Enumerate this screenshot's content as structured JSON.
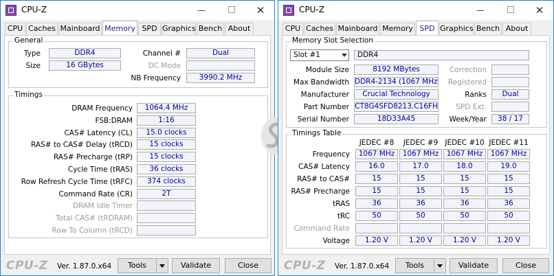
{
  "left": {
    "title": "CPU-Z",
    "tabs": [
      "CPU",
      "Caches",
      "Mainboard",
      "Memory",
      "SPD",
      "Graphics",
      "Bench",
      "About"
    ],
    "active_tab": "Memory",
    "general": {
      "title": "General",
      "type_label": "Type",
      "type": "DDR4",
      "size_label": "Size",
      "size": "16 GBytes",
      "channel_label": "Channel #",
      "channel": "Dual",
      "dcmode_label": "DC Mode",
      "dcmode": "",
      "nbfreq_label": "NB Frequency",
      "nbfreq": "3990.2 MHz"
    },
    "timings": {
      "title": "Timings",
      "rows": [
        {
          "label": "DRAM Frequency",
          "value": "1064.4 MHz",
          "disabled": false
        },
        {
          "label": "FSB:DRAM",
          "value": "1:16",
          "disabled": false
        },
        {
          "label": "CAS# Latency (CL)",
          "value": "15.0 clocks",
          "disabled": false
        },
        {
          "label": "RAS# to CAS# Delay (tRCD)",
          "value": "15 clocks",
          "disabled": false
        },
        {
          "label": "RAS# Precharge (tRP)",
          "value": "15 clocks",
          "disabled": false
        },
        {
          "label": "Cycle Time (tRAS)",
          "value": "36 clocks",
          "disabled": false
        },
        {
          "label": "Row Refresh Cycle Time (tRFC)",
          "value": "374 clocks",
          "disabled": false
        },
        {
          "label": "Command Rate (CR)",
          "value": "2T",
          "disabled": false
        },
        {
          "label": "DRAM Idle Timer",
          "value": "",
          "disabled": true
        },
        {
          "label": "Total CAS# (tRDRAM)",
          "value": "",
          "disabled": true
        },
        {
          "label": "Row To Column (tRCD)",
          "value": "",
          "disabled": true
        }
      ]
    },
    "footer": {
      "brand": "CPU-Z",
      "version": "Ver. 1.87.0.x64",
      "tools": "Tools",
      "validate": "Validate",
      "close": "Close"
    }
  },
  "right": {
    "title": "CPU-Z",
    "tabs": [
      "CPU",
      "Caches",
      "Mainboard",
      "Memory",
      "SPD",
      "Graphics",
      "Bench",
      "About"
    ],
    "active_tab": "SPD",
    "slot": {
      "title": "Memory Slot Selection",
      "selected": "Slot #1",
      "type": "DDR4",
      "module_size_label": "Module Size",
      "module_size": "8192 MBytes",
      "max_bw_label": "Max Bandwidth",
      "max_bw": "DDR4-2134 (1067 MHz)",
      "manufacturer_label": "Manufacturer",
      "manufacturer": "Crucial Technology",
      "part_label": "Part Number",
      "part": "CT8G4SFD8213.C16FH",
      "serial_label": "Serial Number",
      "serial": "18D33A45",
      "correction_label": "Correction",
      "correction": "",
      "registered_label": "Registered",
      "registered": "",
      "ranks_label": "Ranks",
      "ranks": "Dual",
      "spdext_label": "SPD Ext.",
      "spdext": "",
      "weekyear_label": "Week/Year",
      "weekyear": "38 / 17"
    },
    "timings_table": {
      "title": "Timings Table",
      "columns": [
        "JEDEC #8",
        "JEDEC #9",
        "JEDEC #10",
        "JEDEC #11"
      ],
      "rows": [
        {
          "label": "Frequency",
          "values": [
            "1067 MHz",
            "1067 MHz",
            "1067 MHz",
            "1067 MHz"
          ],
          "disabled": false
        },
        {
          "label": "CAS# Latency",
          "values": [
            "16.0",
            "17.0",
            "18.0",
            "19.0"
          ],
          "disabled": false
        },
        {
          "label": "RAS# to CAS#",
          "values": [
            "15",
            "15",
            "15",
            "15"
          ],
          "disabled": false
        },
        {
          "label": "RAS# Precharge",
          "values": [
            "15",
            "15",
            "15",
            "15"
          ],
          "disabled": false
        },
        {
          "label": "tRAS",
          "values": [
            "36",
            "36",
            "36",
            "36"
          ],
          "disabled": false
        },
        {
          "label": "tRC",
          "values": [
            "50",
            "50",
            "50",
            "50"
          ],
          "disabled": false
        },
        {
          "label": "Command Rate",
          "values": [
            "",
            "",
            "",
            ""
          ],
          "disabled": true
        },
        {
          "label": "Voltage",
          "values": [
            "1.20 V",
            "1.20 V",
            "1.20 V",
            "1.20 V"
          ],
          "disabled": false
        }
      ]
    },
    "footer": {
      "brand": "CPU-Z",
      "version": "Ver. 1.87.0.x64",
      "tools": "Tools",
      "validate": "Validate",
      "close": "Close"
    }
  },
  "colors": {
    "value_text": "#00009c",
    "value_bg": "#f3f3fb",
    "window_border": "#1883d7",
    "app_icon": "#7d4aa6"
  }
}
